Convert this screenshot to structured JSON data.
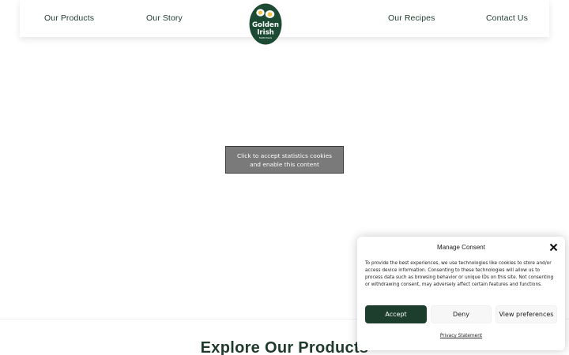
{
  "header": {
    "nav": {
      "products": "Our Products",
      "story": "Our Story",
      "recipes": "Our Recipes",
      "contact": "Contact Us"
    },
    "logo": {
      "line1": "Golden",
      "line2": "Irish",
      "tagline": "FARM EGGS",
      "color": "#1d4a33",
      "yolk_color": "#f5c542"
    }
  },
  "content_placeholder": {
    "text": "Click to accept statistics cookies and enable this content"
  },
  "section": {
    "heading": "Explore Our Products"
  },
  "consent": {
    "title": "Manage Consent",
    "body": "To provide the best experiences, we use technologies like cookies to store and/or access device information. Consenting to these technologies will allow us to process data such as browsing behavior or unique IDs on this site. Not consenting or withdrawing consent, may adversely affect certain features and functions.",
    "accept_label": "Accept",
    "deny_label": "Deny",
    "preferences_label": "View preferences",
    "privacy_link": "Privacy Statement",
    "accent_color": "#1d3d2d"
  }
}
